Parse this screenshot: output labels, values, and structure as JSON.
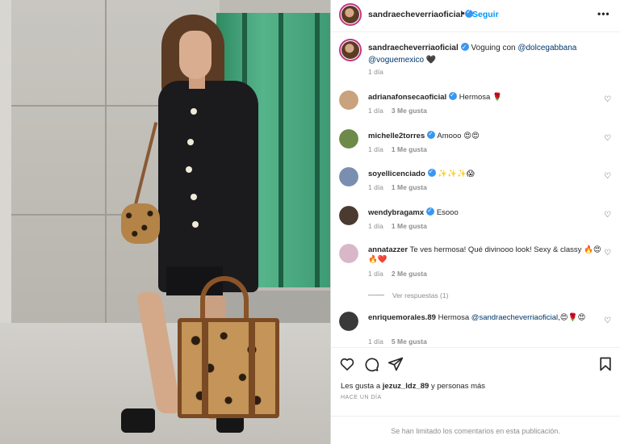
{
  "post": {
    "username": "sandraecheverriaoficial",
    "follow_label": "Seguir",
    "separator": "•",
    "more_label": "•••",
    "caption_text": "Voguing con ",
    "caption_tag1": "@dolcegabbana",
    "caption_tag2": "@voguemexico",
    "caption_emoji": "🖤",
    "caption_time": "1 día"
  },
  "comments": [
    {
      "user": "adrianafonsecaoficial",
      "verified": true,
      "pre": "",
      "tag": "",
      "text": "Hermosa 🌹",
      "time": "1 día",
      "likes": "3 Me gusta",
      "avatar_color": "#c9a27e"
    },
    {
      "user": "michelle2torres",
      "verified": true,
      "pre": "",
      "tag": "",
      "text": "Amooo 😍😍",
      "time": "1 día",
      "likes": "1 Me gusta",
      "avatar_color": "#6d8a4a"
    },
    {
      "user": "soyellicenciado",
      "verified": true,
      "pre": "",
      "tag": "",
      "text": "✨✨✨😱",
      "time": "1 día",
      "likes": "1 Me gusta",
      "avatar_color": "#7a8fb0"
    },
    {
      "user": "wendybragamx",
      "verified": true,
      "pre": "",
      "tag": "",
      "text": "Esooo",
      "time": "1 día",
      "likes": "1 Me gusta",
      "avatar_color": "#4a3a30"
    },
    {
      "user": "annatazzer",
      "verified": false,
      "pre": "",
      "tag": "",
      "text": "Te ves hermosa! Qué divinooo look! Sexy & classy 🔥😍🔥❤️",
      "time": "1 día",
      "likes": "2 Me gusta",
      "avatar_color": "#d8b8c8"
    },
    {
      "user": "enriquemorales.89",
      "verified": false,
      "pre": "Hermosa ",
      "tag": "@sandraecheverriaoficial",
      "text": ",😍🌹😍",
      "time": "1 día",
      "likes": "5 Me gusta",
      "avatar_color": "#3a3a3a"
    }
  ],
  "view_replies": "Ver respuestas (1)",
  "actions": {
    "like_icon": "heart-icon",
    "comment_icon": "comment-icon",
    "share_icon": "share-icon",
    "save_icon": "bookmark-icon"
  },
  "likes_prefix": "Les gusta a ",
  "likes_user": "jezuz_ldz_89",
  "likes_suffix": " y personas más",
  "post_time": "HACE UN DÍA",
  "comments_limited": "Se han limitado los comentarios en esta publicación.",
  "colors": {
    "accent": "#0095f6",
    "verified": "#3897f0",
    "tag": "#00376b",
    "muted": "#8e8e8e"
  }
}
